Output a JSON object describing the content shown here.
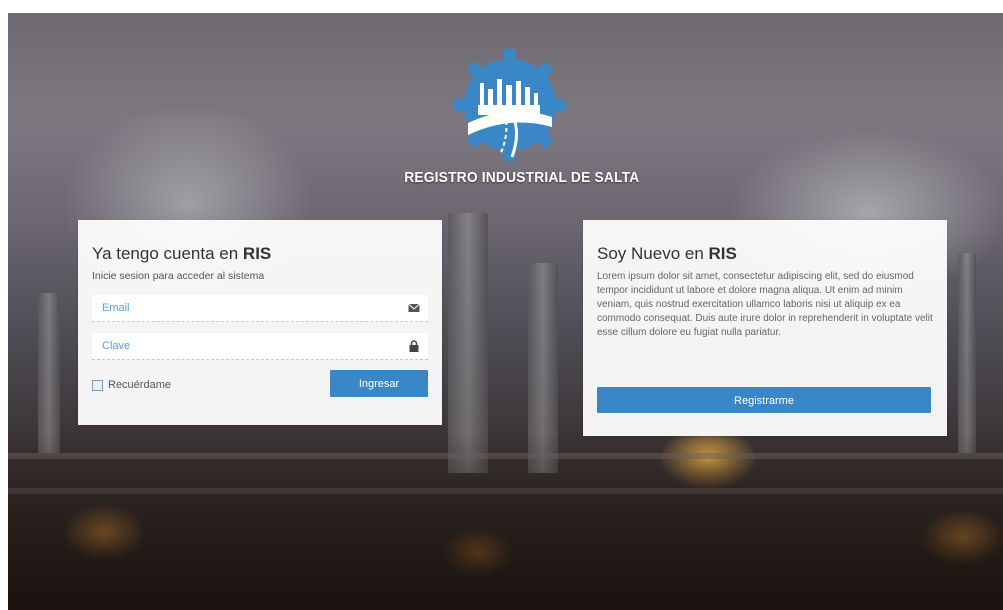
{
  "logo": {
    "text": "REGISTRO INDUSTRIAL DE SALTA",
    "icon": "factory-gear-icon",
    "color": "#3a87c8"
  },
  "login": {
    "title_prefix": "Ya tengo cuenta en ",
    "title_bold": "RIS",
    "subtitle": "Inicie sesion para acceder al sistema",
    "email_placeholder": "Email",
    "email_icon": "envelope-icon",
    "password_placeholder": "Clave",
    "password_icon": "lock-icon",
    "remember_label": "Recuérdame",
    "submit_label": "Ingresar"
  },
  "register": {
    "title_prefix": "Soy Nuevo en ",
    "title_bold": "RIS",
    "body": "Lorem ipsum dolor sit amet, consectetur adipiscing elit, sed do eiusmod tempor incididunt ut labore et dolore magna aliqua. Ut enim ad minim veniam, quis nostrud exercitation ullamco laboris nisi ut aliquip ex ea commodo consequat. Duis aute irure dolor in reprehenderit in voluptate velit esse cillum dolore eu fugiat nulla pariatur.",
    "button_label": "Registrarme"
  },
  "colors": {
    "accent": "#3a87c8",
    "placeholder": "#5aa0d4"
  }
}
